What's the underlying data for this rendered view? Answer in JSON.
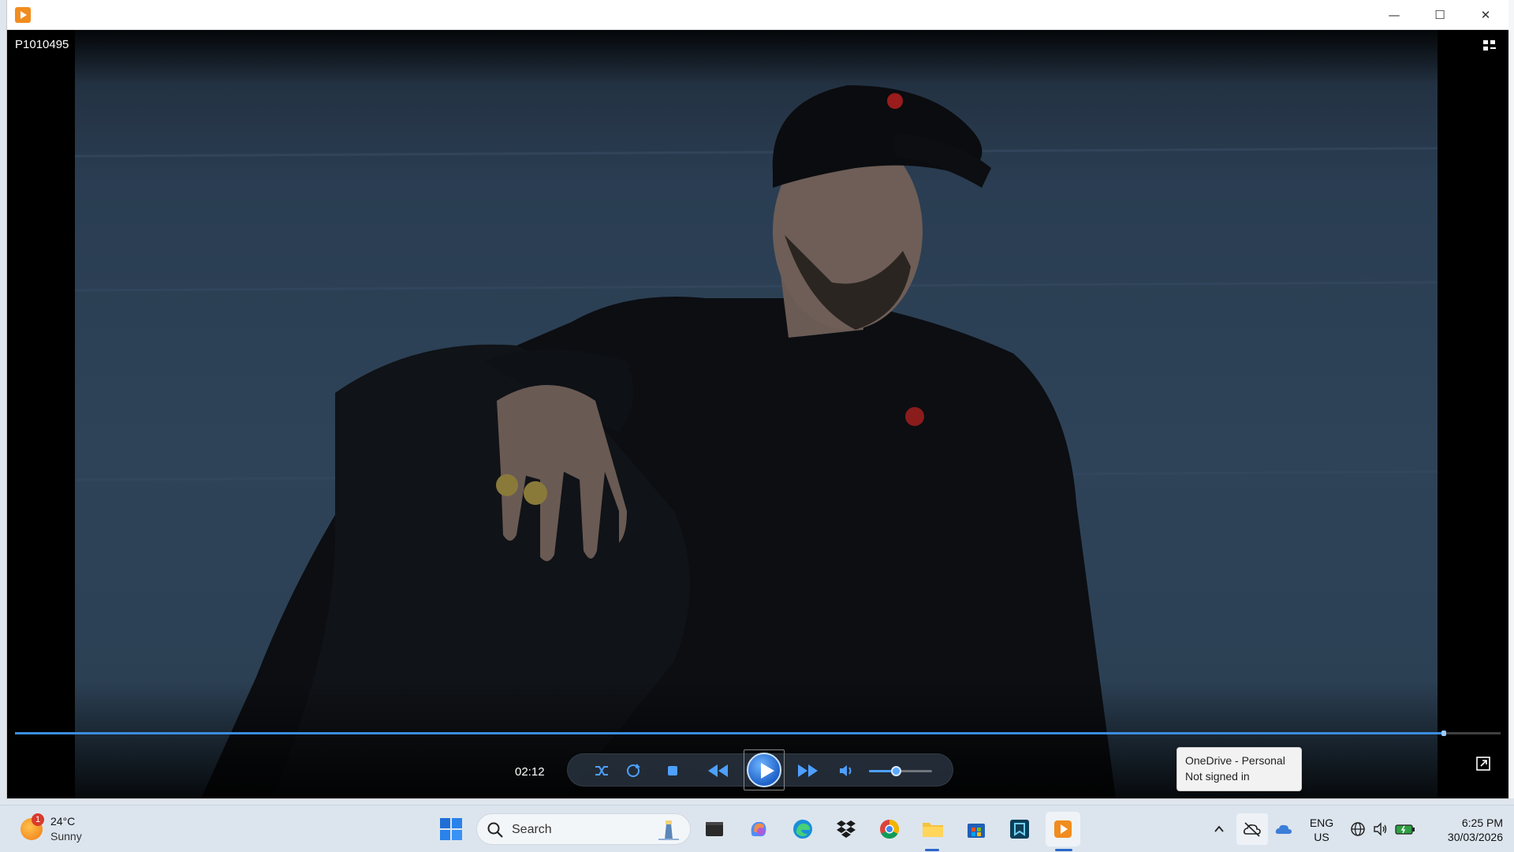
{
  "window": {
    "title": "",
    "video_title": "P1010495",
    "controls": {
      "minimize": "—",
      "maximize": "☐",
      "close": "✕"
    }
  },
  "player": {
    "time_elapsed": "02:12",
    "seek_progress": 0.962,
    "volume_level": 0.42,
    "buttons": [
      "shuffle-icon",
      "repeat-icon",
      "stop-icon",
      "previous-icon",
      "play-icon",
      "next-icon",
      "volume-icon"
    ]
  },
  "tooltip": {
    "line1": "OneDrive - Personal",
    "line2": "Not signed in"
  },
  "taskbar": {
    "weather": {
      "temp": "24°C",
      "condition": "Sunny",
      "alert_count": "1"
    },
    "search_placeholder": "Search",
    "language": {
      "line1": "ENG",
      "line2": "US"
    },
    "clock": {
      "time": "6:25 PM",
      "date": "30/03/2026"
    },
    "pinned": [
      "windows-start-icon",
      "search-icon",
      "file-explorer-dark-icon",
      "copilot-icon",
      "edge-icon",
      "dropbox-icon",
      "chrome-icon",
      "folder-icon",
      "microsoft-store-icon",
      "app-icon",
      "media-player-icon"
    ]
  },
  "colors": {
    "accent": "#3b8de0",
    "video_bg": "#2e4358",
    "taskbar_bg": "#dce5ee"
  }
}
